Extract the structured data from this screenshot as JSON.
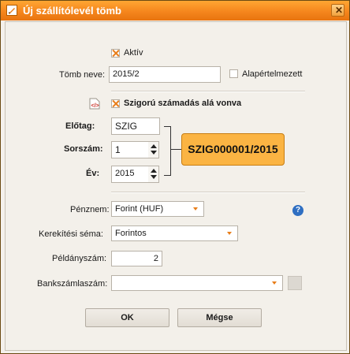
{
  "window": {
    "title": "Új szállítólevél tömb",
    "close_glyph": "✕"
  },
  "active": {
    "label": "Aktív",
    "checked": true
  },
  "tomb_neve": {
    "label": "Tömb neve:",
    "value": "2015/2"
  },
  "default": {
    "label": "Alapértelmezett",
    "checked": false
  },
  "strict": {
    "label": "Szigorú számadás alá vonva",
    "checked": true
  },
  "prefix": {
    "label": "Előtag:",
    "value": "SZIG"
  },
  "serial": {
    "label": "Sorszám:",
    "value": "1"
  },
  "year": {
    "label": "Év:",
    "value": "2015"
  },
  "preview": "SZIG000001/2015",
  "currency": {
    "label": "Pénznem:",
    "value": "Forint  (HUF)"
  },
  "rounding": {
    "label": "Kerekítési séma:",
    "value": "Forintos"
  },
  "copies": {
    "label": "Példányszám:",
    "value": "2"
  },
  "bank": {
    "label": "Bankszámlaszám:",
    "value": ""
  },
  "help_glyph": "?",
  "buttons": {
    "ok": "OK",
    "cancel": "Mégse"
  },
  "colors": {
    "titlebar": "#f5861d",
    "accent": "#e87e1a",
    "preview_bg": "#fbb443",
    "help": "#2f6fc2"
  }
}
